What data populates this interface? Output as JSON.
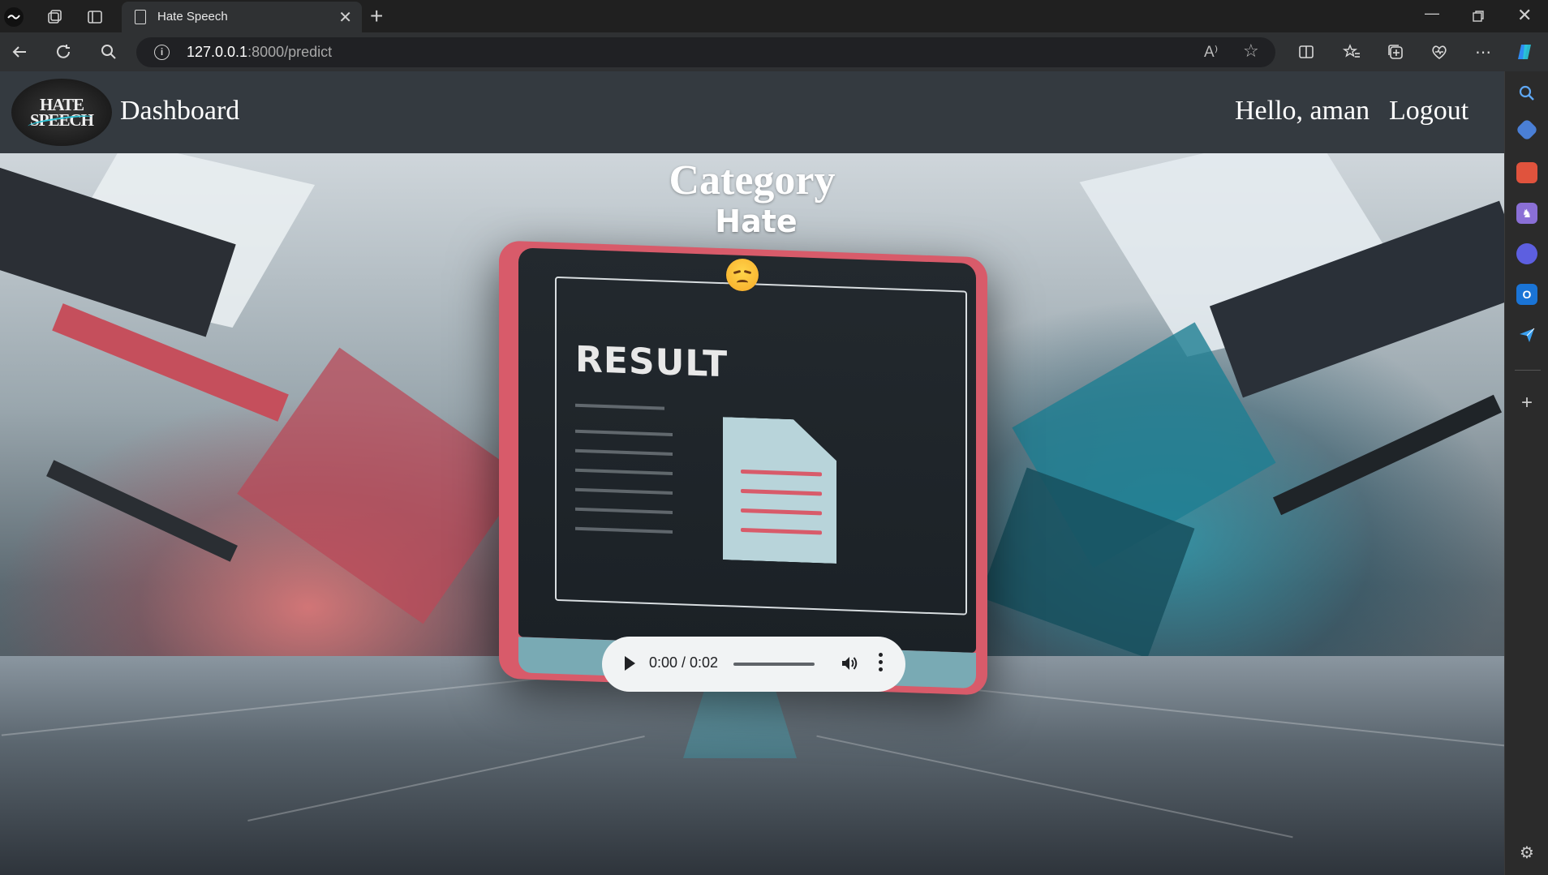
{
  "browser": {
    "tab_title": "Hate Speech",
    "tab_close": "✕",
    "new_tab": "+",
    "url_host": "127.0.0.1",
    "url_rest": ":8000/predict",
    "read_aloud": "A⁾"
  },
  "navbar": {
    "logo_line1": "HATE",
    "logo_line2": "SPEECH",
    "brand": "Dashboard",
    "greeting": "Hello, aman",
    "logout": "Logout"
  },
  "result": {
    "heading": "Category",
    "value": "Hate",
    "emoji": "sad-face"
  },
  "screen_art": {
    "title": "RESULT"
  },
  "audio_player": {
    "time": "0:00 / 0:02",
    "progress": 0
  },
  "colors": {
    "navbar_bg": "#343a40",
    "monitor_accent": "#d85b6a",
    "teal_accent": "#2ec4d6"
  }
}
